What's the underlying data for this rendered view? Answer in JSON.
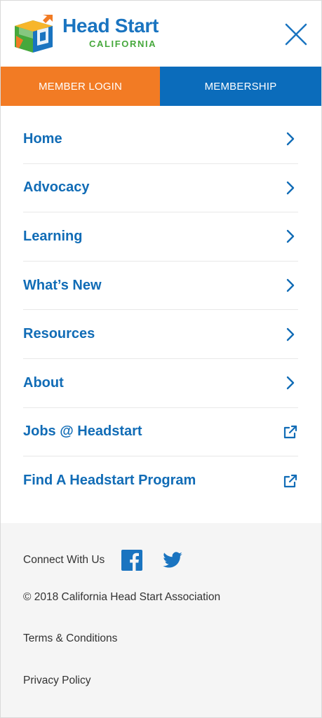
{
  "header": {
    "logo_title": "Head Start",
    "logo_subtitle": "CALIFORNIA",
    "close_icon": "close-icon"
  },
  "auth": {
    "login_label": "MEMBER LOGIN",
    "membership_label": "MEMBERSHIP"
  },
  "nav": {
    "items": [
      {
        "label": "Home",
        "icon": "chevron-right-icon"
      },
      {
        "label": "Advocacy",
        "icon": "chevron-right-icon"
      },
      {
        "label": "Learning",
        "icon": "chevron-right-icon"
      },
      {
        "label": "What’s New",
        "icon": "chevron-right-icon"
      },
      {
        "label": "Resources",
        "icon": "chevron-right-icon"
      },
      {
        "label": "About",
        "icon": "chevron-right-icon"
      },
      {
        "label": "Jobs @ Headstart",
        "icon": "external-link-icon"
      },
      {
        "label": "Find A Headstart Program",
        "icon": "external-link-icon"
      }
    ]
  },
  "footer": {
    "connect_label": "Connect With Us",
    "social": [
      "facebook-icon",
      "twitter-icon"
    ],
    "copyright": "© 2018 California Head Start Association",
    "terms_label": "Terms & Conditions",
    "privacy_label": "Privacy Policy"
  },
  "colors": {
    "brand_blue": "#1a74c0",
    "brand_green": "#46a83c",
    "login_orange": "#f27b24",
    "membership_blue": "#0b6cbb",
    "footer_bg": "#f5f5f5"
  }
}
